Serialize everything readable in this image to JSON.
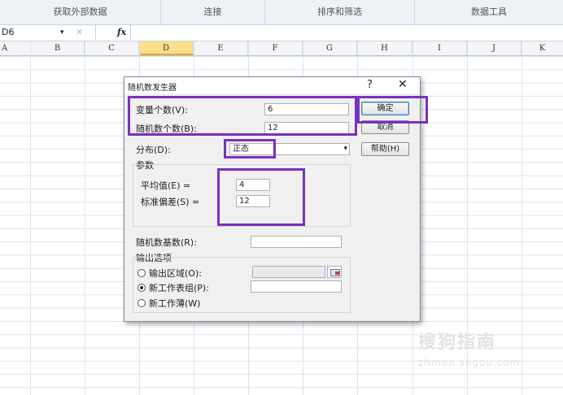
{
  "ribbon": {
    "groups": [
      "获取外部数据",
      "连接",
      "排序和筛选",
      "数据工具"
    ]
  },
  "formula_bar": {
    "name_box": "D6",
    "fx_label": "fx",
    "cancel_symbol": "✕",
    "dropdown_symbol": "▾"
  },
  "columns": [
    "A",
    "B",
    "C",
    "D",
    "E",
    "F",
    "G",
    "H",
    "I",
    "J",
    "K"
  ],
  "selected_column": "D",
  "dialog": {
    "title": "随机数发生器",
    "help_symbol": "?",
    "close_symbol": "✕",
    "fields": {
      "variables_label": "变量个数(V):",
      "variables_value": "6",
      "random_count_label": "随机数个数(B):",
      "random_count_value": "12",
      "distribution_label": "分布(D):",
      "distribution_value": "正态",
      "params_label": "参数",
      "mean_label": "平均值(E) =",
      "mean_value": "4",
      "stddev_label": "标准偏差(S) =",
      "stddev_value": "12",
      "seed_label": "随机数基数(R):",
      "seed_value": "",
      "output_label": "输出选项",
      "output_range_label": "输出区域(O):",
      "new_sheet_label": "新工作表组(P):",
      "new_workbook_label": "新工作薄(W)",
      "range_picker_icon": "range-select-icon"
    },
    "buttons": {
      "ok": "确定",
      "cancel": "取消",
      "help": "帮助(H)"
    },
    "selected_output": "new_sheet"
  },
  "watermark": {
    "title": "搜狗指南",
    "url": "zhinan.sogou.com"
  },
  "colors": {
    "highlight": "#7b2fbf",
    "selected_column_bg": "#fbdf8c",
    "dialog_bg": "#f0f0f0"
  }
}
